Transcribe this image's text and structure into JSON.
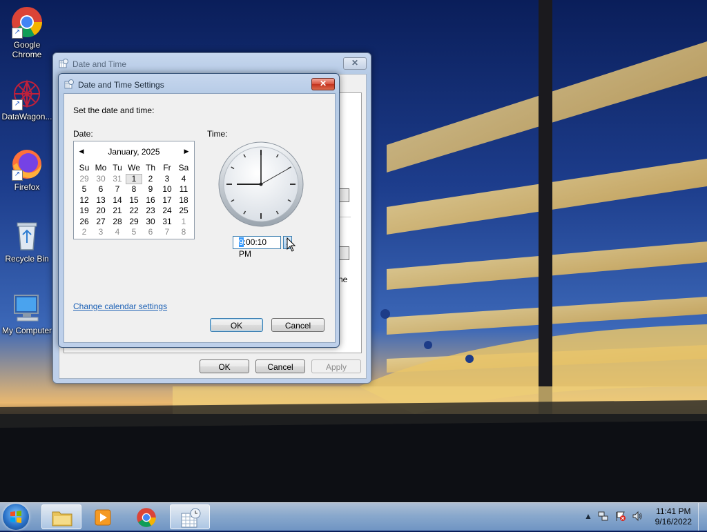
{
  "desktop": {
    "icons": [
      {
        "label": "Google Chrome",
        "icon": "chrome-icon"
      },
      {
        "label": "DataWagon...",
        "icon": "datawagon-icon"
      },
      {
        "label": "Firefox",
        "icon": "firefox-icon"
      },
      {
        "label": "Recycle Bin",
        "icon": "recycle-bin-icon"
      },
      {
        "label": "My Computer",
        "icon": "computer-icon"
      }
    ]
  },
  "back_window": {
    "title": "Date and Time",
    "partial_text": "ne",
    "buttons": {
      "ok": "OK",
      "cancel": "Cancel",
      "apply": "Apply"
    }
  },
  "settings_dialog": {
    "title": "Date and Time Settings",
    "prompt": "Set the date and time:",
    "date_label": "Date:",
    "time_label": "Time:",
    "calendar": {
      "month_year": "January, 2025",
      "weekdays": [
        "Su",
        "Mo",
        "Tu",
        "We",
        "Th",
        "Fr",
        "Sa"
      ],
      "weeks": [
        [
          "29",
          "30",
          "31",
          "1",
          "2",
          "3",
          "4"
        ],
        [
          "5",
          "6",
          "7",
          "8",
          "9",
          "10",
          "11"
        ],
        [
          "12",
          "13",
          "14",
          "15",
          "16",
          "17",
          "18"
        ],
        [
          "19",
          "20",
          "21",
          "22",
          "23",
          "24",
          "25"
        ],
        [
          "26",
          "27",
          "28",
          "29",
          "30",
          "31",
          "1"
        ],
        [
          "2",
          "3",
          "4",
          "5",
          "6",
          "7",
          "8"
        ]
      ],
      "selected_day": "1"
    },
    "time_value_highlight": "9",
    "time_value_rest": ":00:10 PM",
    "change_calendar_link": "Change calendar settings",
    "ok": "OK",
    "cancel": "Cancel"
  },
  "taskbar": {
    "time": "11:41 PM",
    "date": "9/16/2022"
  },
  "colors": {
    "accent": "#3399ff",
    "link": "#1a5fb4"
  }
}
